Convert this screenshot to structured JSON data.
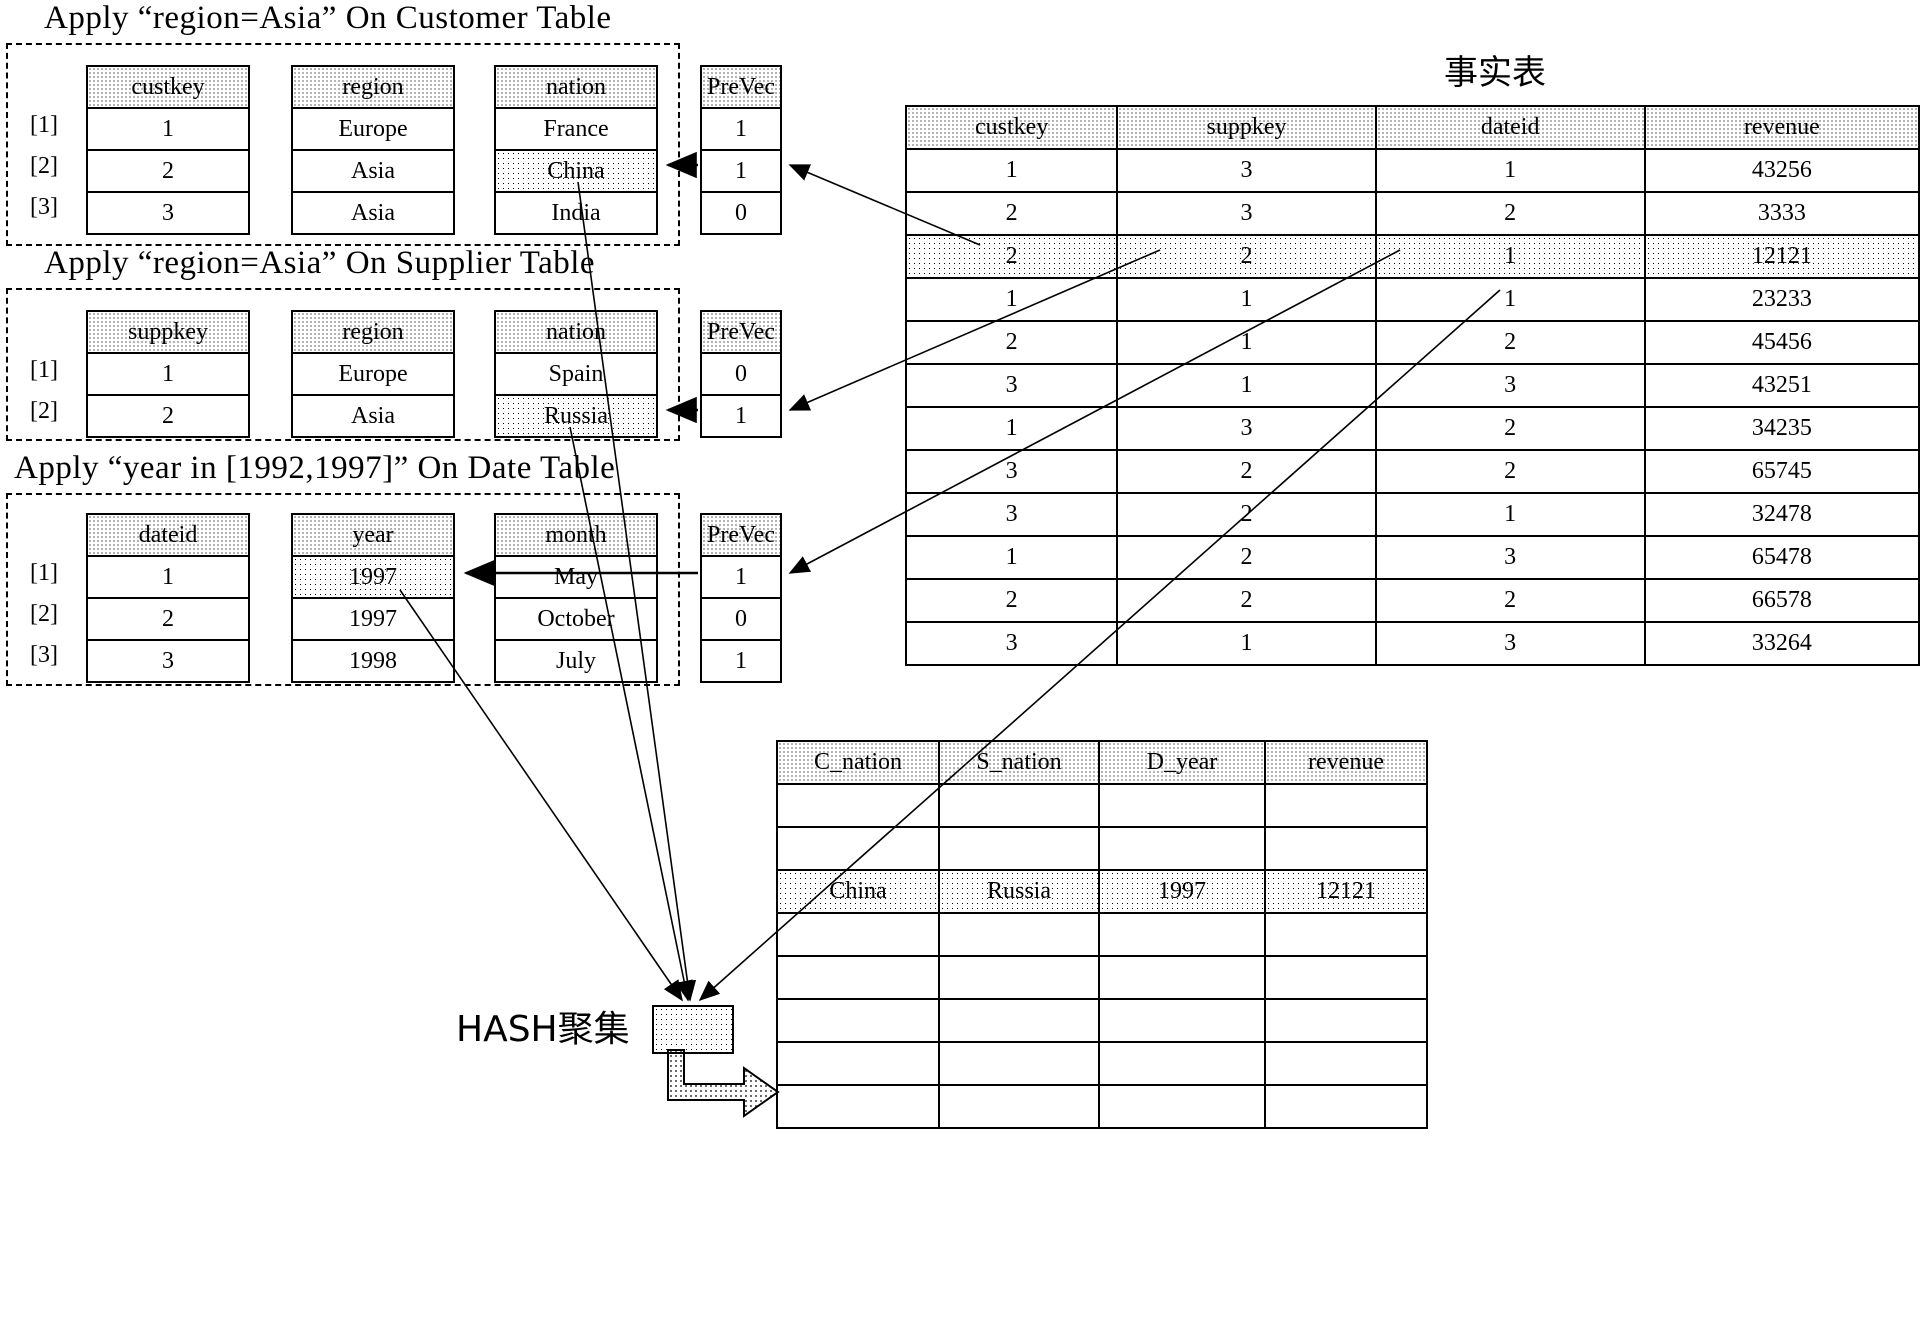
{
  "sections": {
    "customer": {
      "caption": "Apply “region=Asia” On Customer Table",
      "row_labels": [
        "[1]",
        "[2]",
        "[3]"
      ],
      "columns": [
        {
          "header": "custkey",
          "values": [
            "1",
            "2",
            "3"
          ]
        },
        {
          "header": "region",
          "values": [
            "Europe",
            "Asia",
            "Asia"
          ]
        },
        {
          "header": "nation",
          "values": [
            "France",
            "China",
            "India"
          ]
        }
      ],
      "prevec": {
        "header": "PreVec",
        "values": [
          "1",
          "1",
          "0"
        ]
      },
      "highlight_row_index": 1
    },
    "supplier": {
      "caption": "Apply “region=Asia” On Supplier Table",
      "row_labels": [
        "[1]",
        "[2]"
      ],
      "columns": [
        {
          "header": "suppkey",
          "values": [
            "1",
            "2"
          ]
        },
        {
          "header": "region",
          "values": [
            "Europe",
            "Asia"
          ]
        },
        {
          "header": "nation",
          "values": [
            "Spain",
            "Russia"
          ]
        }
      ],
      "prevec": {
        "header": "PreVec",
        "values": [
          "0",
          "1"
        ]
      },
      "highlight_row_index": 1
    },
    "date": {
      "caption": "Apply “year in [1992,1997]” On Date Table",
      "row_labels": [
        "[1]",
        "[2]",
        "[3]"
      ],
      "columns": [
        {
          "header": "dateid",
          "values": [
            "1",
            "2",
            "3"
          ]
        },
        {
          "header": "year",
          "values": [
            "1997",
            "1997",
            "1998"
          ]
        },
        {
          "header": "month",
          "values": [
            "May",
            "October",
            "July"
          ]
        }
      ],
      "prevec": {
        "header": "PreVec",
        "values": [
          "1",
          "0",
          "1"
        ]
      },
      "highlight_row_index": 0
    }
  },
  "fact_table": {
    "title": "事实表",
    "headers": [
      "custkey",
      "suppkey",
      "dateid",
      "revenue"
    ],
    "rows": [
      [
        "1",
        "3",
        "1",
        "43256"
      ],
      [
        "2",
        "3",
        "2",
        "3333"
      ],
      [
        "2",
        "2",
        "1",
        "12121"
      ],
      [
        "1",
        "1",
        "1",
        "23233"
      ],
      [
        "2",
        "1",
        "2",
        "45456"
      ],
      [
        "3",
        "1",
        "3",
        "43251"
      ],
      [
        "1",
        "3",
        "2",
        "34235"
      ],
      [
        "3",
        "2",
        "2",
        "65745"
      ],
      [
        "3",
        "2",
        "1",
        "32478"
      ],
      [
        "1",
        "2",
        "3",
        "65478"
      ],
      [
        "2",
        "2",
        "2",
        "66578"
      ],
      [
        "3",
        "1",
        "3",
        "33264"
      ]
    ],
    "highlight_row_index": 2
  },
  "hash": {
    "label": "HASH聚集"
  },
  "result_table": {
    "headers": [
      "C_nation",
      "S_nation",
      "D_year",
      "revenue"
    ],
    "rows": [
      [
        "",
        "",
        "",
        ""
      ],
      [
        "",
        "",
        "",
        ""
      ],
      [
        "China",
        "Russia",
        "1997",
        "12121"
      ],
      [
        "",
        "",
        "",
        ""
      ],
      [
        "",
        "",
        "",
        ""
      ],
      [
        "",
        "",
        "",
        ""
      ],
      [
        "",
        "",
        "",
        ""
      ],
      [
        "",
        "",
        "",
        ""
      ]
    ],
    "highlight_row_index": 2
  }
}
